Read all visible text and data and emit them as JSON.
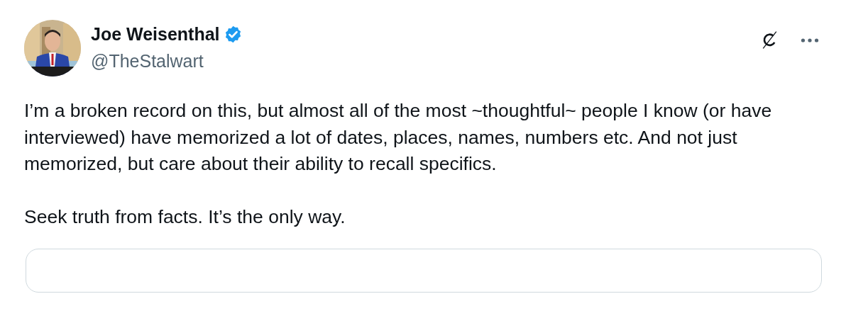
{
  "author": {
    "name": "Joe Weisenthal",
    "verified": true,
    "handle": "@TheStalwart"
  },
  "paragraphs": [
    "I’m a broken record on this, but almost all of the most ~thoughtful~ people I know (or have interviewed) have memorized a lot of dates, places, names, numbers etc. And not just memorized, but care about their ability to recall specifics.",
    "Seek truth from facts. It’s the only way."
  ],
  "quoted_card": {
    "kind": "card"
  }
}
